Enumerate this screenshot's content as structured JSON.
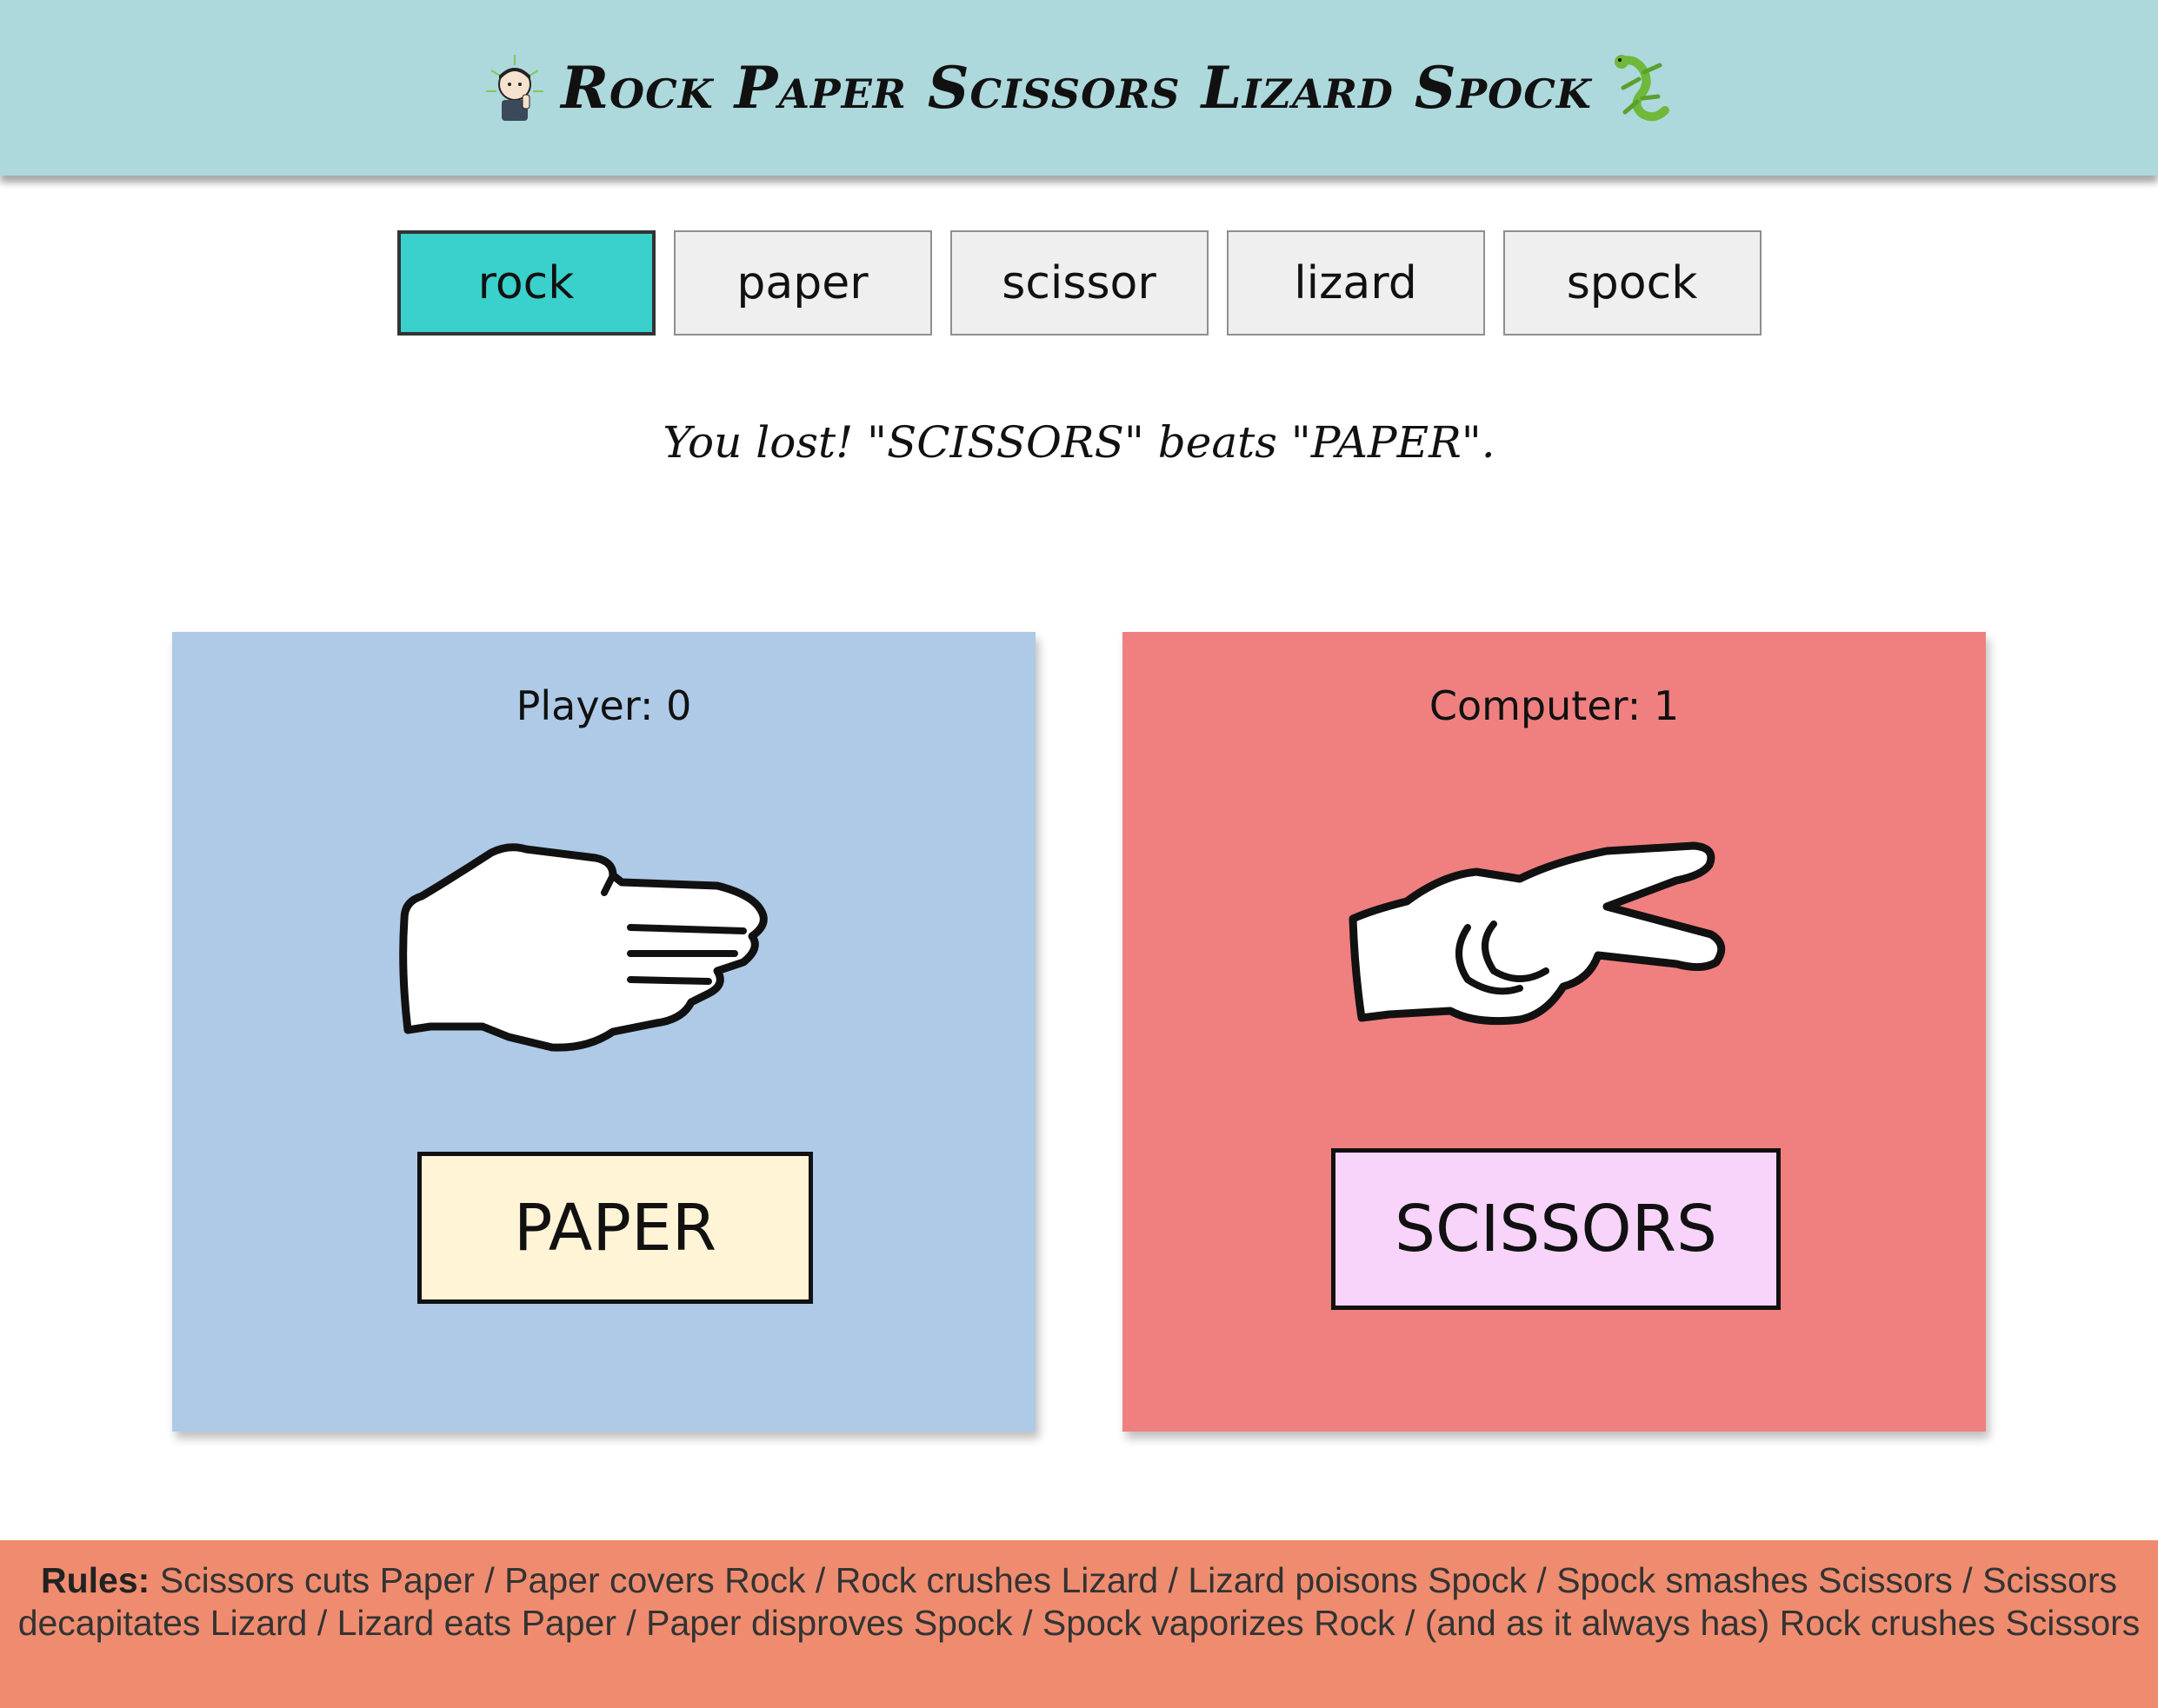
{
  "header": {
    "title": "Rock Paper Scissors Lizard Spock",
    "left_icon": "spock-avatar-icon",
    "right_icon": "lizard-icon"
  },
  "choices": [
    {
      "label": "rock",
      "selected": true
    },
    {
      "label": "paper",
      "selected": false
    },
    {
      "label": "scissor",
      "selected": false
    },
    {
      "label": "lizard",
      "selected": false
    },
    {
      "label": "spock",
      "selected": false
    }
  ],
  "result": "You lost! \"SCISSORS\" beats \"PAPER\".",
  "player": {
    "score_text": "Player: 0",
    "pick": "PAPER",
    "hand_icon": "paper-hand-icon",
    "color": "#aecae6"
  },
  "computer": {
    "score_text": "Computer: 1",
    "pick": "SCISSORS",
    "hand_icon": "scissors-hand-icon",
    "color": "#f08080"
  },
  "footer": {
    "rules_label": "Rules:",
    "rules_text": "Scissors cuts Paper / Paper covers Rock / Rock crushes Lizard / Lizard poisons Spock / Spock smashes Scissors / Scissors decapitates Lizard / Lizard eats Paper / Paper disproves Spock / Spock vaporizes Rock / (and as it always has) Rock crushes Scissors"
  },
  "colors": {
    "header_bg": "#add8dc",
    "selected_choice": "#3ad1cc",
    "footer_bg": "#ef8c6f"
  }
}
